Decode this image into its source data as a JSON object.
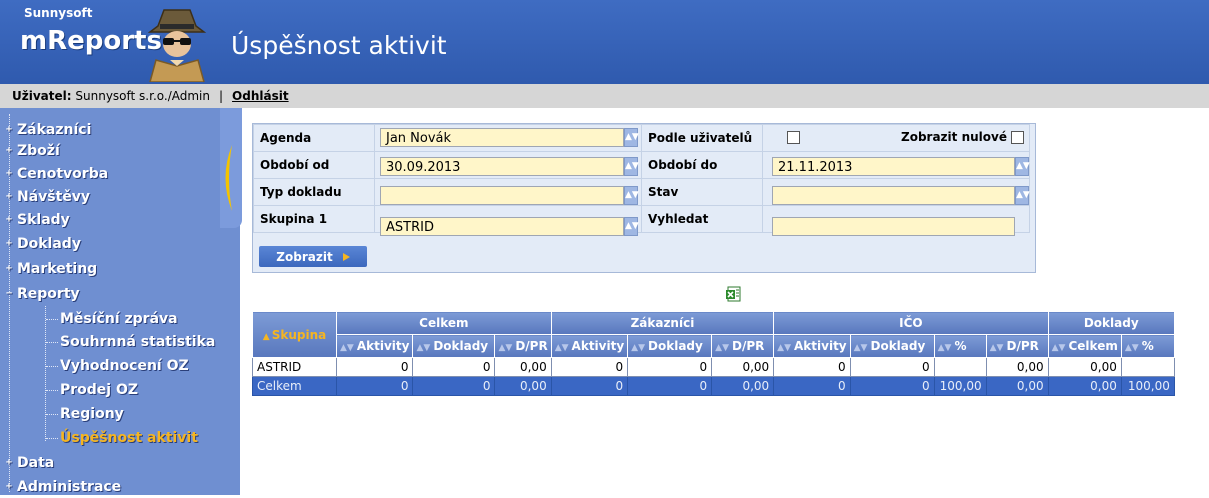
{
  "app": {
    "vendor": "Sunnysoft",
    "name": "mReports",
    "page_title": "Úspěšnost aktivit"
  },
  "userbar": {
    "user_label": "Uživatel:",
    "user_value": "Sunnysoft s.r.o./Admin",
    "separator": "|",
    "logout": "Odhlásit"
  },
  "sidebar": {
    "items": [
      {
        "label": "Zákazníci"
      },
      {
        "label": "Zboží"
      },
      {
        "label": "Cenotvorba"
      },
      {
        "label": "Návštěvy"
      },
      {
        "label": "Sklady"
      },
      {
        "label": "Doklady"
      },
      {
        "label": "Marketing"
      },
      {
        "label": "Reporty",
        "expanded": true
      },
      {
        "label": "Data"
      },
      {
        "label": "Administrace"
      }
    ],
    "report_items": [
      {
        "label": "Měsíční zpráva"
      },
      {
        "label": "Souhrnná statistika"
      },
      {
        "label": "Vyhodnocení OZ"
      },
      {
        "label": "Prodej OZ"
      },
      {
        "label": "Regiony"
      },
      {
        "label": "Úspěšnost aktivit",
        "active": true
      }
    ]
  },
  "filter": {
    "agenda_label": "Agenda",
    "agenda_value": "Jan Novák",
    "by_users_label": "Podle uživatelů",
    "by_users_checked": false,
    "show_zero_label": "Zobrazit nulové",
    "show_zero_checked": false,
    "period_from_label": "Období od",
    "period_from_value": "30.09.2013",
    "period_to_label": "Období do",
    "period_to_value": "21.11.2013",
    "doc_type_label": "Typ dokladu",
    "doc_type_value": "",
    "state_label": "Stav",
    "state_value": "",
    "group1_label": "Skupina 1",
    "group1_value": "ASTRID",
    "search_label": "Vyhledat",
    "search_value": "",
    "submit_label": "Zobrazit"
  },
  "export": {
    "icon": "excel-icon"
  },
  "report": {
    "group_key_header": "Skupina",
    "groups": [
      "Celkem",
      "Zákazníci",
      "IČO",
      "Doklady"
    ],
    "columns": [
      "Aktivity",
      "Doklady",
      "D/PR",
      "Aktivity",
      "Doklady",
      "D/PR",
      "Aktivity",
      "Doklady",
      "%",
      "D/PR",
      "Celkem",
      "%"
    ],
    "rows": [
      {
        "name": "ASTRID",
        "cells": [
          "0",
          "0",
          "0,00",
          "0",
          "0",
          "0,00",
          "0",
          "0",
          "",
          "0,00",
          "0,00",
          ""
        ]
      }
    ],
    "total": {
      "name": "Celkem",
      "cells": [
        "0",
        "0",
        "0,00",
        "0",
        "0",
        "0,00",
        "0",
        "0",
        "100,00",
        "0,00",
        "0,00",
        "100,00"
      ]
    }
  },
  "colors": {
    "header_blue": "#2f5aae",
    "sidebar_blue": "#6f8fd1",
    "active_orange": "#f5b521",
    "field_yellow": "#fff6c9",
    "total_row": "#3a67c4"
  }
}
